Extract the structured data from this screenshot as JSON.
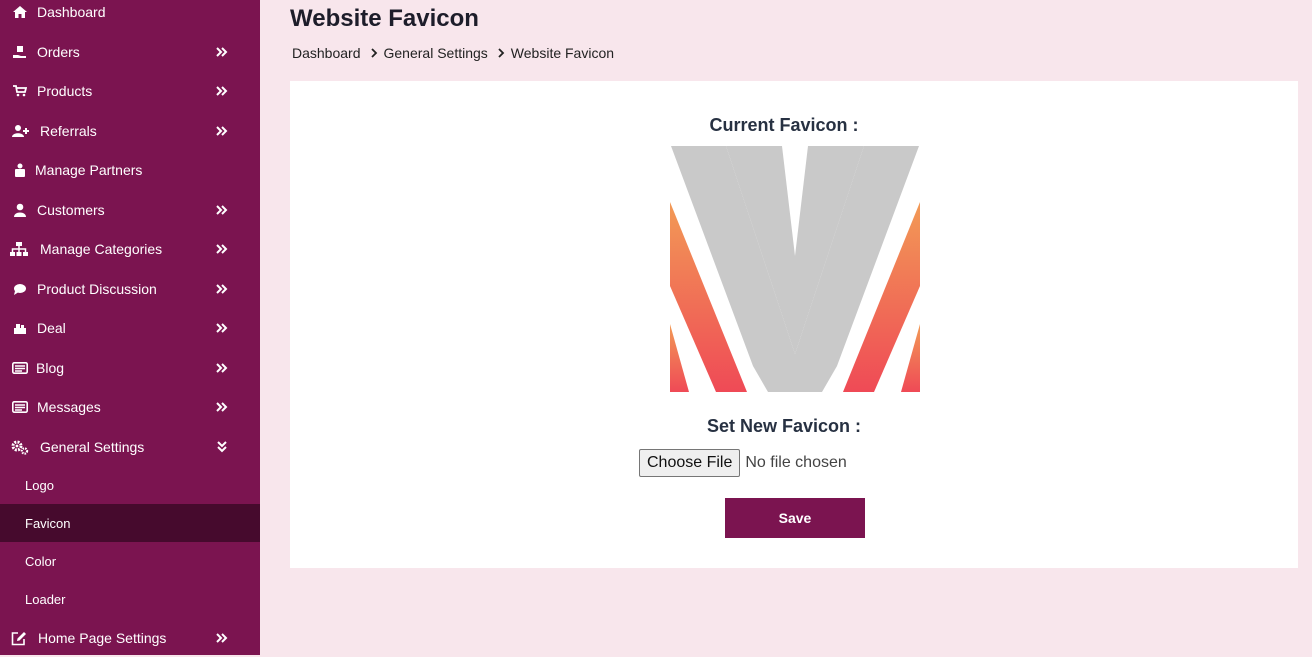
{
  "sidebar": {
    "items": [
      {
        "label": "Dashboard",
        "icon": "home-icon"
      },
      {
        "label": "Orders",
        "icon": "hand-box-icon"
      },
      {
        "label": "Products",
        "icon": "cart-icon"
      },
      {
        "label": "Referrals",
        "icon": "user-plus-icon"
      },
      {
        "label": "Manage Partners",
        "icon": "partners-icon"
      },
      {
        "label": "Customers",
        "icon": "user-icon"
      },
      {
        "label": "Manage Categories",
        "icon": "sitemap-icon"
      },
      {
        "label": "Product Discussion",
        "icon": "chat-icon"
      },
      {
        "label": "Deal",
        "icon": "deal-icon"
      },
      {
        "label": "Blog",
        "icon": "news-icon"
      },
      {
        "label": "Messages",
        "icon": "messages-icon"
      },
      {
        "label": "General Settings",
        "icon": "cogs-icon"
      },
      {
        "label": "Home Page Settings",
        "icon": "edit-icon"
      }
    ],
    "general_settings_sub": [
      {
        "label": "Logo"
      },
      {
        "label": "Favicon"
      },
      {
        "label": "Color"
      },
      {
        "label": "Loader"
      }
    ]
  },
  "header": {
    "title": "Website Favicon",
    "breadcrumb": [
      "Dashboard",
      "General Settings",
      "Website Favicon"
    ]
  },
  "main": {
    "current_favicon_label": "Current Favicon :",
    "set_new_label": "Set New Favicon :",
    "choose_file_label": "Choose File",
    "file_status": "No file chosen",
    "save_label": "Save"
  },
  "colors": {
    "sidebar_bg": "#7b1450",
    "sidebar_active": "#460a2d",
    "page_bg": "#f8e6ec",
    "accent": "#7b1450",
    "favicon_gray": "#c9c9c9",
    "favicon_gradient_top": "#f29a56",
    "favicon_gradient_bottom": "#ef4a56"
  }
}
